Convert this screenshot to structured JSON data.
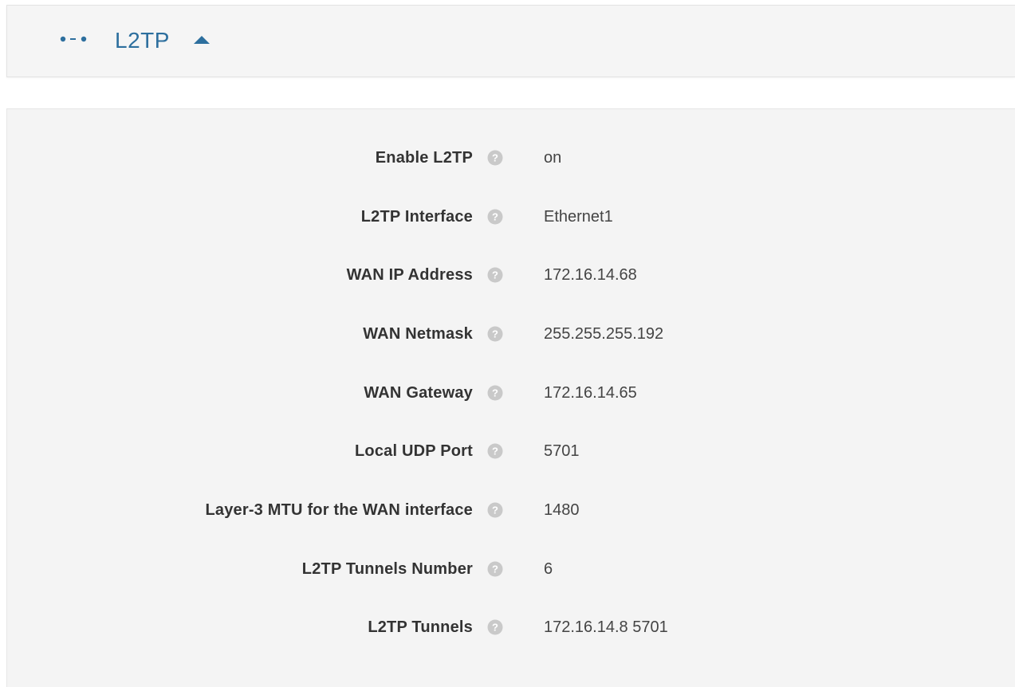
{
  "header": {
    "title": "L2TP",
    "icon": "connection-dots-icon",
    "toggle_icon": "caret-up-icon",
    "accent_color": "#2d6f9e"
  },
  "settings": [
    {
      "label": "Enable L2TP",
      "value": "on",
      "help_icon": "help-circle-icon"
    },
    {
      "label": "L2TP Interface",
      "value": "Ethernet1",
      "help_icon": "help-circle-icon"
    },
    {
      "label": "WAN IP Address",
      "value": "172.16.14.68",
      "help_icon": "help-circle-icon"
    },
    {
      "label": "WAN Netmask",
      "value": "255.255.255.192",
      "help_icon": "help-circle-icon"
    },
    {
      "label": "WAN Gateway",
      "value": "172.16.14.65",
      "help_icon": "help-circle-icon"
    },
    {
      "label": "Local UDP Port",
      "value": "5701",
      "help_icon": "help-circle-icon"
    },
    {
      "label": "Layer-3 MTU for the WAN interface",
      "value": "1480",
      "help_icon": "help-circle-icon"
    },
    {
      "label": "L2TP Tunnels Number",
      "value": "6",
      "help_icon": "help-circle-icon"
    },
    {
      "label": "L2TP Tunnels",
      "value": "172.16.14.8 5701",
      "help_icon": "help-circle-icon"
    }
  ]
}
